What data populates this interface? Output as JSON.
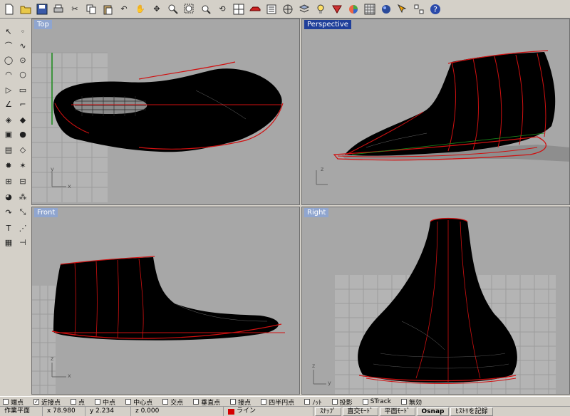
{
  "toolbar": {
    "icons": [
      "new-file",
      "open-folder",
      "save",
      "print",
      "cut",
      "copy",
      "paste",
      "undo",
      "pan-hand",
      "move",
      "zoom",
      "zoom-window",
      "zoom-extents",
      "rotate-view",
      "four-viewports",
      "car",
      "properties",
      "target",
      "layer",
      "light",
      "render",
      "color-wheel",
      "grid",
      "sphere",
      "pointer",
      "options",
      "help"
    ]
  },
  "viewports": {
    "top": {
      "title": "Top"
    },
    "perspective": {
      "title": "Perspective"
    },
    "front": {
      "title": "Front"
    },
    "right": {
      "title": "Right"
    }
  },
  "axes": {
    "x": "x",
    "y": "y",
    "z": "z"
  },
  "osnap": {
    "items": [
      {
        "label": "端点",
        "checked": false
      },
      {
        "label": "近接点",
        "checked": true
      },
      {
        "label": "点",
        "checked": false
      },
      {
        "label": "中点",
        "checked": false
      },
      {
        "label": "中心点",
        "checked": false
      },
      {
        "label": "交点",
        "checked": false
      },
      {
        "label": "垂直点",
        "checked": false
      },
      {
        "label": "接点",
        "checked": false
      },
      {
        "label": "四半円点",
        "checked": false
      },
      {
        "label": "ﾉｯﾄ",
        "checked": false
      },
      {
        "label": "投影",
        "checked": false
      },
      {
        "label": "STrack",
        "checked": false
      },
      {
        "label": "無効",
        "checked": false
      }
    ]
  },
  "status": {
    "plane": "作業平面",
    "x": "x 78.980",
    "y": "y 2.234",
    "z": "z 0.000",
    "layer": "ライン",
    "layer_color": "#d40000",
    "snap": "ｽﾅｯﾌﾟ",
    "ortho": "直交ﾓｰﾄﾞ",
    "planar": "平面ﾓｰﾄﾞ",
    "osnap_btn": "Osnap",
    "history": "ﾋｽﾄﾘを記録"
  }
}
